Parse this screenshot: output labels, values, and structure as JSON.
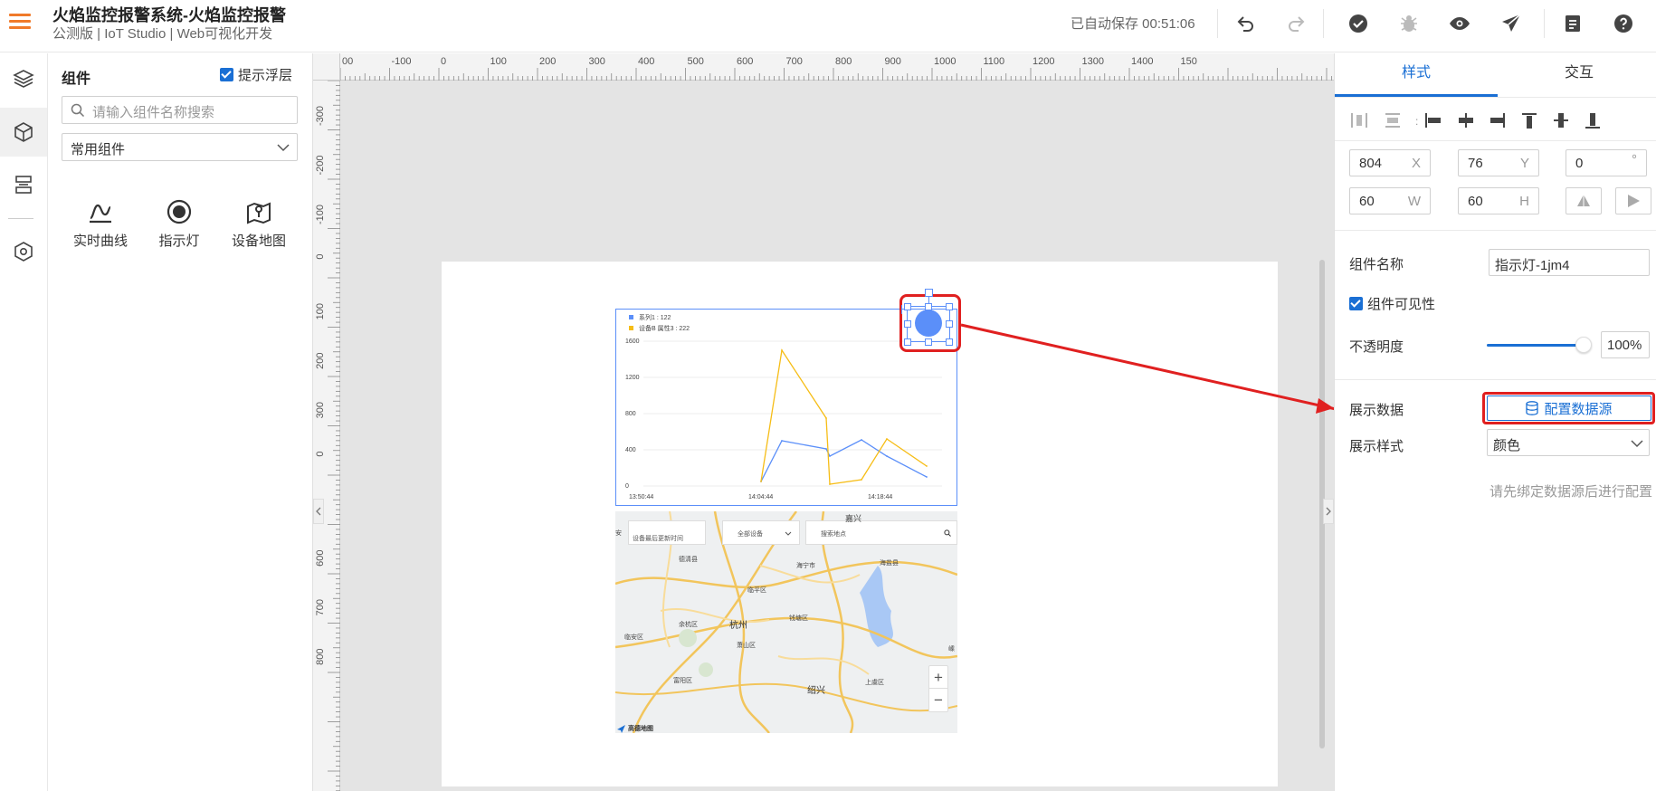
{
  "header": {
    "title": "火焰监控报警系统-火焰监控报警",
    "subtitle": "公测版 | IoT Studio | Web可视化开发",
    "autosave": "已自动保存 00:51:06",
    "accent_color": "#f07a2a",
    "icons": [
      "undo-icon",
      "redo-icon",
      "check-circle-icon",
      "bug-icon",
      "eye-icon",
      "send-icon",
      "document-icon",
      "help-icon"
    ]
  },
  "left_rail": {
    "items": [
      "layers-icon",
      "cube-icon",
      "list-icon",
      "settings-hex-icon"
    ]
  },
  "components_panel": {
    "title": "组件",
    "tip_label": "提示浮层",
    "search_placeholder": "请输入组件名称搜索",
    "category": "常用组件",
    "items": [
      {
        "label": "实时曲线",
        "icon": "realtime-curve-icon"
      },
      {
        "label": "指示灯",
        "icon": "indicator-light-icon"
      },
      {
        "label": "设备地图",
        "icon": "device-map-icon"
      }
    ]
  },
  "ruler": {
    "h_labels": [
      "00",
      "-100",
      "0",
      "100",
      "200",
      "300",
      "400",
      "500",
      "600",
      "700",
      "800",
      "900",
      "1000",
      "1100",
      "1200",
      "1300",
      "1400",
      "150"
    ],
    "v_labels": [
      "-300",
      "-200",
      "-100",
      "0",
      "100",
      "200",
      "300",
      "0",
      "500",
      "600",
      "700",
      "800"
    ]
  },
  "chart_widget": {
    "legend": [
      "系列1 : 122",
      "设备B 属性3 : 222"
    ],
    "series_colors": [
      "#5b8ff9",
      "#f6bd16"
    ],
    "y_ticks": [
      "1600",
      "1200",
      "800",
      "400",
      "0"
    ],
    "x_ticks": [
      "13:50:44",
      "14:04:44",
      "14:18:44"
    ]
  },
  "map_widget": {
    "time_placeholder": "设备最后更新时间",
    "device_filter": "全部设备",
    "search_placeholder": "搜索地点",
    "places": [
      "嘉兴",
      "安",
      "德清县",
      "海宁市",
      "海盐县",
      "临平区",
      "余杭区",
      "杭州",
      "钱塘区",
      "临安区",
      "萧山区",
      "富阳区",
      "绍兴",
      "上虞区",
      "嵊"
    ],
    "zoom_in": "+",
    "zoom_out": "−",
    "logo": "高德地图",
    "water_color": "#a9c8f5"
  },
  "chart_data": {
    "type": "line",
    "x": [
      "13:50:44",
      "14:04:44",
      "14:18:44"
    ],
    "ylim": [
      0,
      1600
    ],
    "series": [
      {
        "name": "系列1",
        "values": [
          50,
          500,
          410,
          330,
          510,
          330,
          100
        ]
      },
      {
        "name": "设备B 属性3",
        "values": [
          50,
          1500,
          750,
          20,
          70,
          520,
          220
        ]
      }
    ]
  },
  "properties": {
    "tabs": [
      "样式",
      "交互"
    ],
    "x": {
      "value": "804",
      "unit": "X"
    },
    "y": {
      "value": "76",
      "unit": "Y"
    },
    "rotation": {
      "value": "0",
      "unit": "°"
    },
    "w": {
      "value": "60",
      "unit": "W"
    },
    "h": {
      "value": "60",
      "unit": "H"
    },
    "name_label": "组件名称",
    "name_value": "指示灯-1jm4",
    "visibility_label": "组件可见性",
    "opacity_label": "不透明度",
    "opacity_value": "100%",
    "opacity_level": 1.0,
    "data_label": "展示数据",
    "config_button": "配置数据源",
    "style_label": "展示样式",
    "style_value": "颜色",
    "hint": "请先绑定数据源后进行配置",
    "accent_color": "#1a6fd4",
    "highlight_color": "#e02020"
  }
}
